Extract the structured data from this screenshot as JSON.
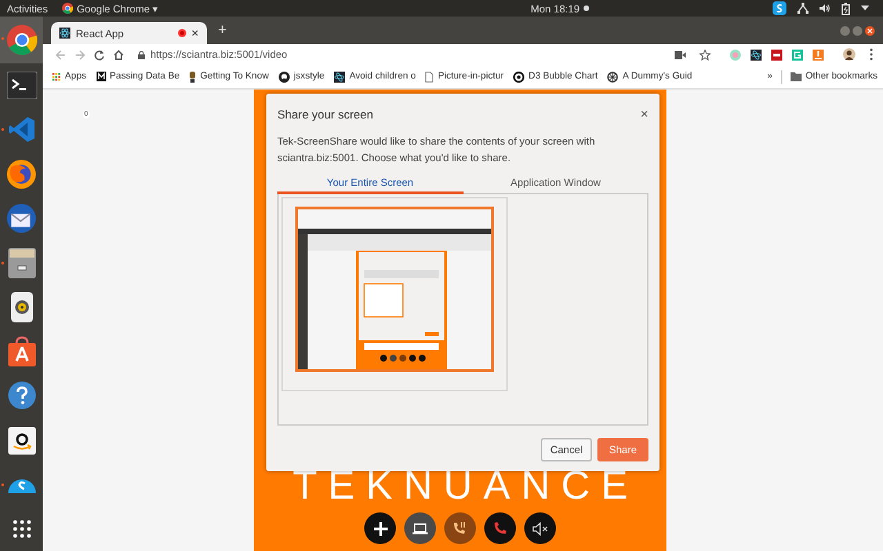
{
  "top_bar": {
    "activities": "Activities",
    "app_menu": "Google Chrome",
    "app_menu_caret": "▾",
    "clock": "Mon 18:19"
  },
  "dock": [
    {
      "kind": "chrome",
      "running": true,
      "selected": true
    },
    {
      "kind": "terminal",
      "running": false,
      "selected": false
    },
    {
      "kind": "editor",
      "running": true,
      "selected": false
    },
    {
      "kind": "firefox",
      "running": false,
      "selected": false
    },
    {
      "kind": "mail",
      "running": false,
      "selected": false
    },
    {
      "kind": "files",
      "running": true,
      "selected": false
    },
    {
      "kind": "speaker",
      "running": false,
      "selected": false
    },
    {
      "kind": "store",
      "running": false,
      "selected": false
    },
    {
      "kind": "help",
      "running": false,
      "selected": false
    },
    {
      "kind": "amazon",
      "running": false,
      "selected": false
    },
    {
      "kind": "skype",
      "running": true,
      "selected": false
    },
    {
      "kind": "grid",
      "running": false,
      "selected": false
    }
  ],
  "browser": {
    "tabs": [
      {
        "title": "React App",
        "selected": true,
        "recording": true,
        "close": "×"
      }
    ],
    "new_tab": "+",
    "url": "https://sciantra.biz:5001/video",
    "bookmarks": [
      {
        "kind": "apps",
        "label": "Apps"
      },
      {
        "kind": "m",
        "label": "Passing Data Be"
      },
      {
        "kind": "bulb",
        "label": "Getting To Know"
      },
      {
        "kind": "github",
        "label": "jsxstyle"
      },
      {
        "kind": "react",
        "label": "Avoid children o"
      },
      {
        "kind": "page",
        "label": "Picture-in-pictur"
      },
      {
        "kind": "ring",
        "label": "D3 Bubble Chart"
      },
      {
        "kind": "gear",
        "label": "A Dummy's Guid"
      }
    ],
    "overflow": "»",
    "other_bookmarks": "Other bookmarks"
  },
  "page": {
    "badge": "0",
    "logo": "TEKNUANCE",
    "controls": [
      {
        "kind": "add"
      },
      {
        "kind": "screen"
      },
      {
        "kind": "hold"
      },
      {
        "kind": "hangup"
      },
      {
        "kind": "mute"
      }
    ]
  },
  "dialog": {
    "title": "Share your screen",
    "close": "×",
    "message": "Tek-ScreenShare would like to share the contents of your screen with sciantra.biz:5001. Choose what you'd like to share.",
    "tabs": [
      {
        "label": "Your Entire Screen",
        "selected": true
      },
      {
        "label": "Application Window",
        "selected": false
      }
    ],
    "sources": [
      {
        "selected": true
      }
    ],
    "buttons": [
      {
        "label": "Cancel",
        "kind": "secondary"
      },
      {
        "label": "Share",
        "kind": "primary"
      }
    ]
  }
}
